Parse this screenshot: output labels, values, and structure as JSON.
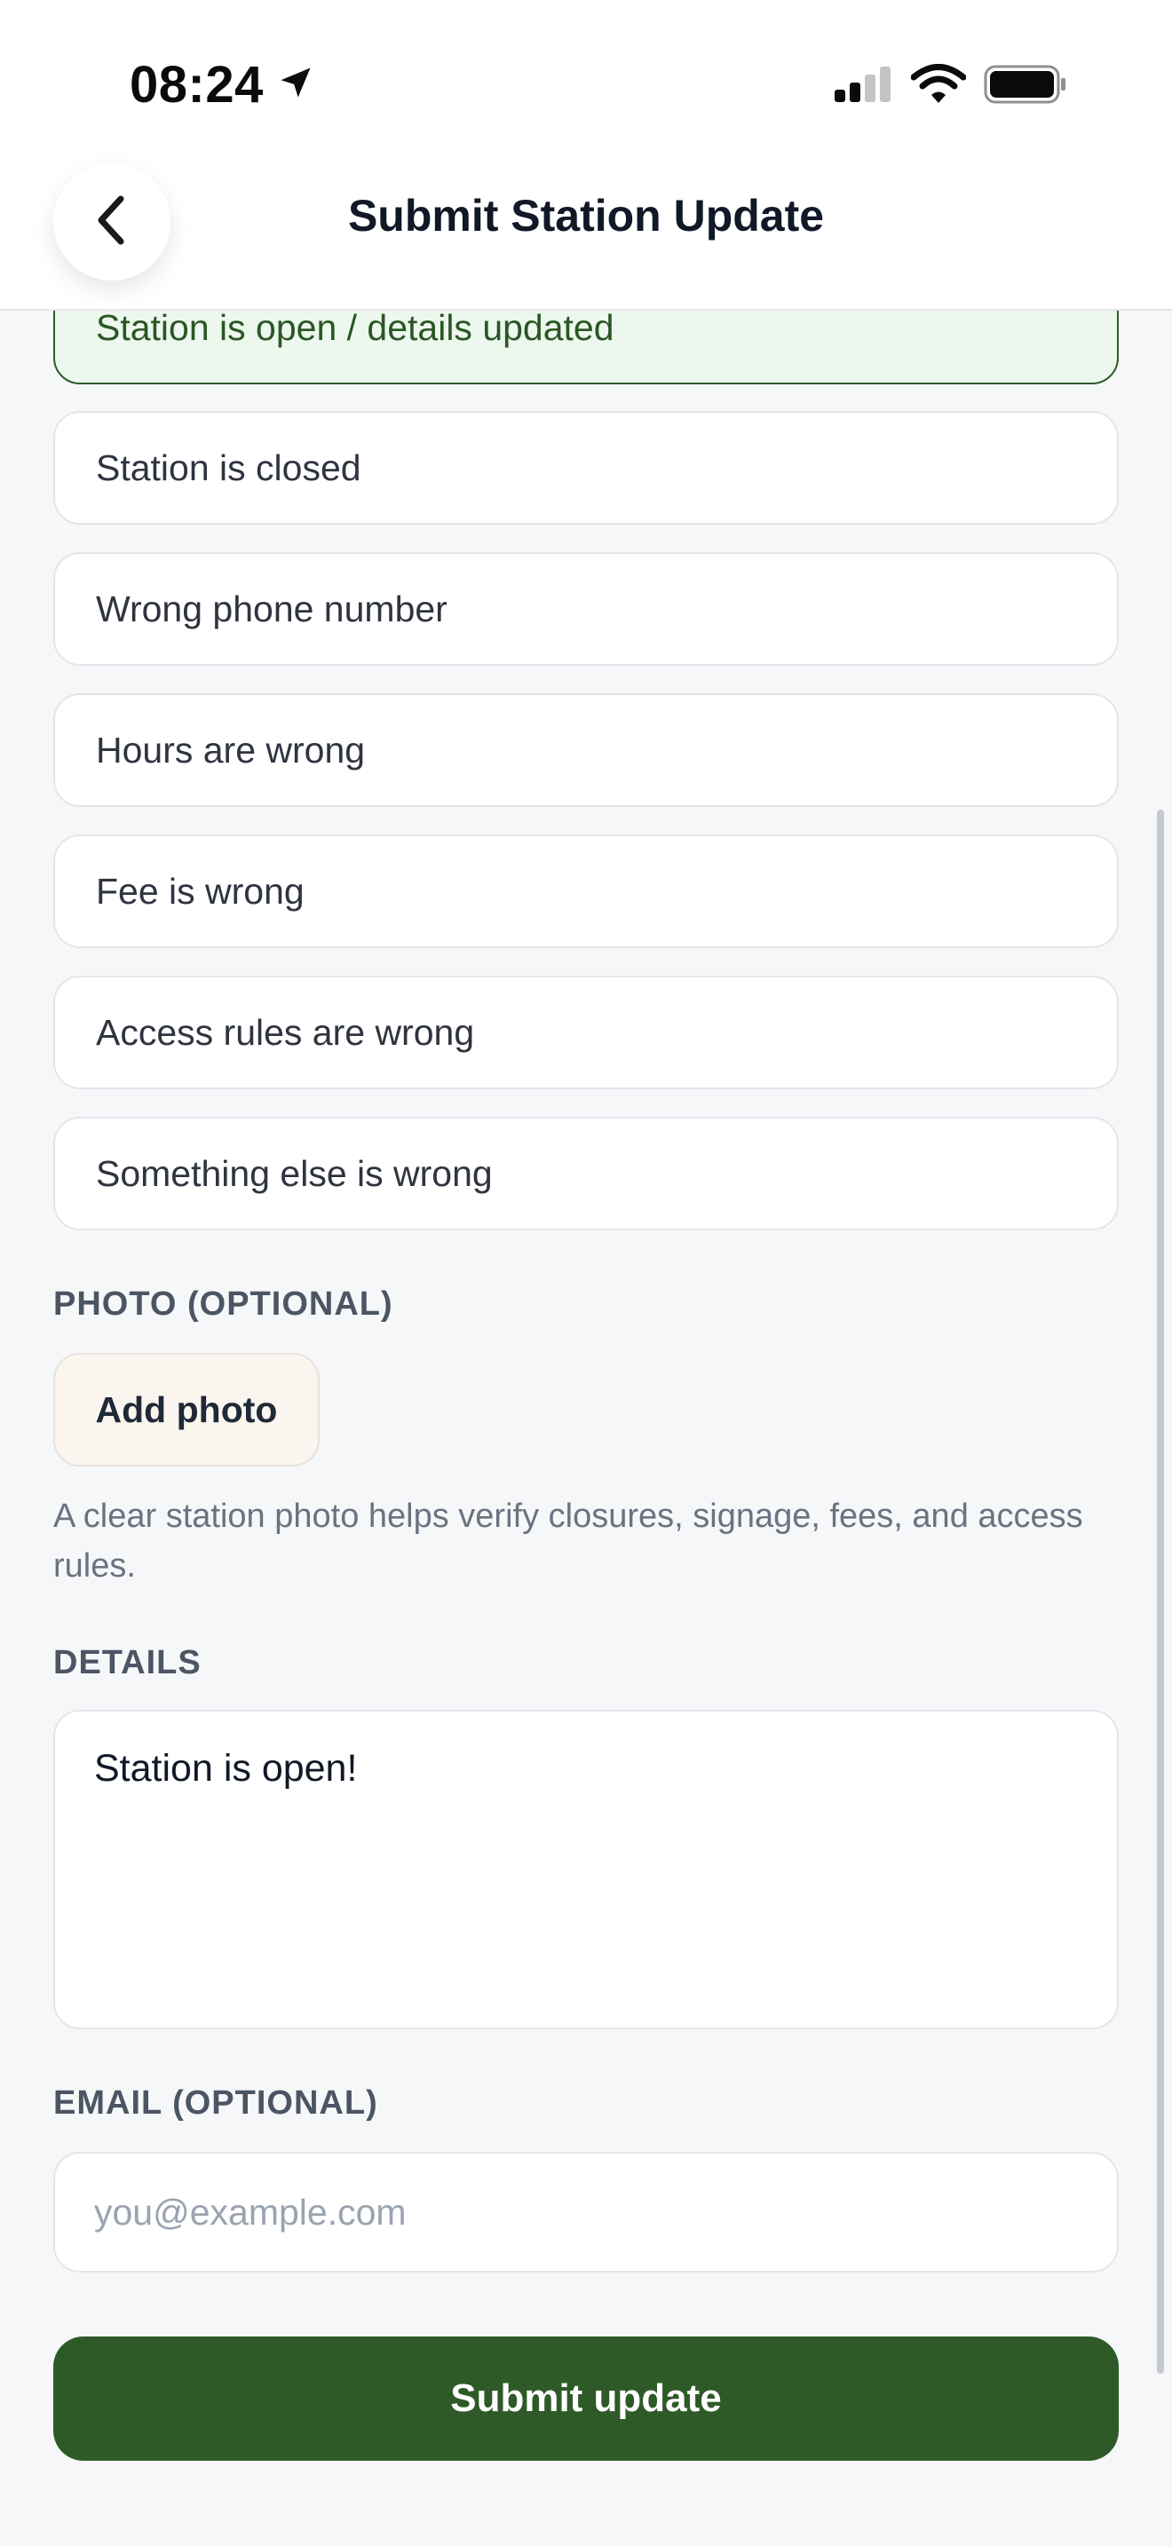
{
  "status": {
    "time": "08:24",
    "icons": [
      "location-arrow-icon",
      "cellular-signal-icon",
      "wifi-icon",
      "battery-icon"
    ]
  },
  "nav": {
    "back_icon": "chevron-left-icon",
    "title": "Submit Station Update"
  },
  "options": [
    {
      "label": "Station is open / details updated",
      "selected": true
    },
    {
      "label": "Station is closed",
      "selected": false
    },
    {
      "label": "Wrong phone number",
      "selected": false
    },
    {
      "label": "Hours are wrong",
      "selected": false
    },
    {
      "label": "Fee is wrong",
      "selected": false
    },
    {
      "label": "Access rules are wrong",
      "selected": false
    },
    {
      "label": "Something else is wrong",
      "selected": false
    }
  ],
  "photo": {
    "label": "PHOTO (OPTIONAL)",
    "button": "Add photo",
    "helper": "A clear station photo helps verify closures, signage, fees, and access rules."
  },
  "details": {
    "label": "DETAILS",
    "value": "Station is open!"
  },
  "email": {
    "label": "EMAIL (OPTIONAL)",
    "placeholder": "you@example.com",
    "value": ""
  },
  "submit": {
    "label": "Submit update"
  },
  "colors": {
    "accent": "#2e5a27",
    "selected_bg": "#ecf7ee",
    "background": "#f6f7f9",
    "add_photo_bg": "#fbf5ef"
  }
}
